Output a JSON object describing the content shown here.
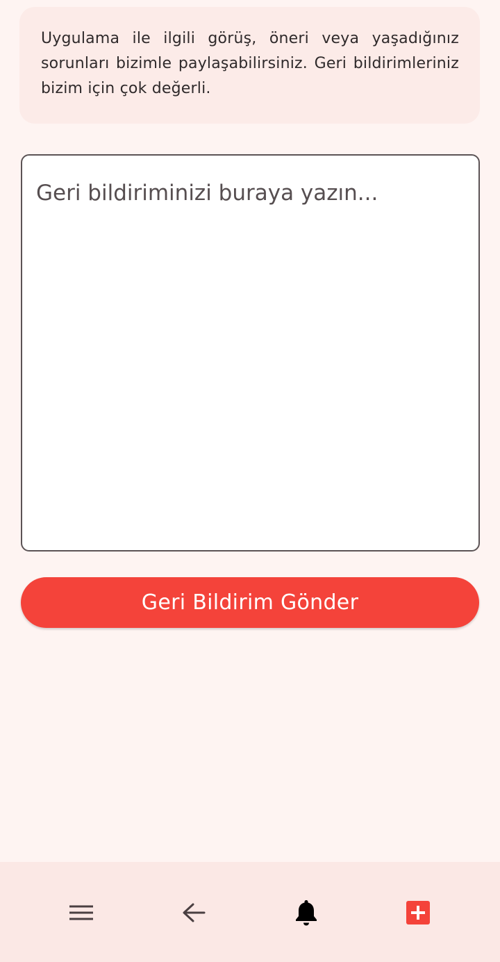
{
  "info": {
    "text": "Uygulama ile ilgili görüş, öneri veya yaşadığınız sorunları bizimle paylaşabilirsiniz. Geri bildirimleriniz bizim için çok değerli."
  },
  "feedback": {
    "value": "",
    "placeholder": "Geri bildiriminizi buraya yazın..."
  },
  "submit": {
    "label": "Geri Bildirim Gönder"
  },
  "bottom_nav": {
    "items": [
      {
        "icon": "menu-icon"
      },
      {
        "icon": "arrow-left-icon"
      },
      {
        "icon": "bell-icon"
      },
      {
        "icon": "plus-square-icon"
      }
    ]
  },
  "colors": {
    "accent": "#f4433a",
    "background": "#fef4f2",
    "card": "#fcebe8",
    "nav": "#fbe8e5"
  }
}
